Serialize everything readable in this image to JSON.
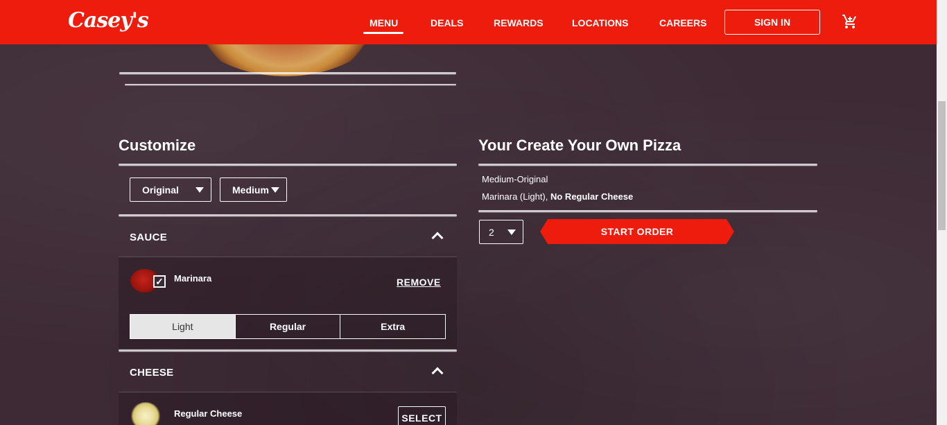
{
  "brand": {
    "logo_text": "Casey's",
    "accent": "#ee1c0c"
  },
  "nav": {
    "items": [
      "MENU",
      "DEALS",
      "REWARDS",
      "LOCATIONS",
      "CAREERS"
    ],
    "active": "MENU",
    "signin_label": "SIGN IN",
    "cart_icon": "cart-icon"
  },
  "customize": {
    "title": "Customize",
    "crust": "Original",
    "size": "Medium",
    "sauce": {
      "heading": "SAUCE",
      "item_label": "Marinara",
      "remove_label": "REMOVE",
      "levels": [
        "Light",
        "Regular",
        "Extra"
      ],
      "selected_level": "Light"
    },
    "cheese": {
      "heading": "CHEESE",
      "item_label": "Regular Cheese",
      "select_label": "SELECT"
    }
  },
  "summary": {
    "title": "Your Create Your Own Pizza",
    "line1": "Medium-Original",
    "line2_prefix": "Marinara (Light), ",
    "line2_bold": "No Regular Cheese",
    "quantity": "2",
    "start_label": "START ORDER"
  }
}
